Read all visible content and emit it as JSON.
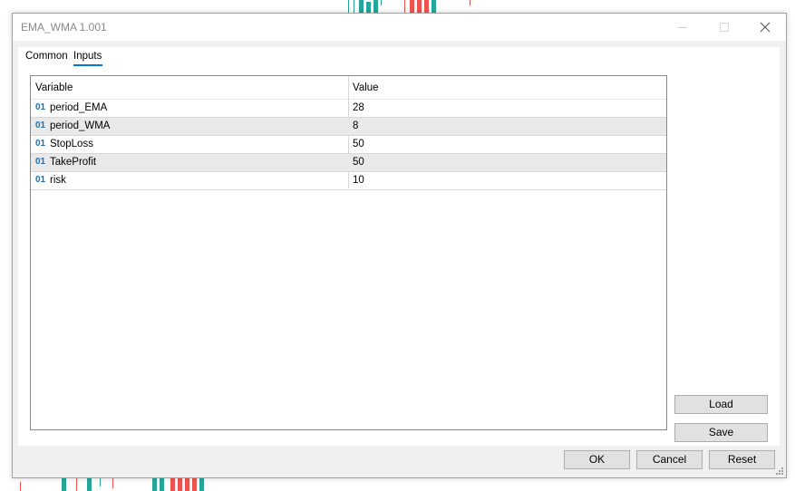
{
  "window": {
    "title": "EMA_WMA 1.001",
    "minimize_glyph": "minimize-icon",
    "maximize_glyph": "maximize-icon",
    "close_glyph": "close-icon"
  },
  "tabs": [
    {
      "label": "Common",
      "active": false
    },
    {
      "label": "Inputs",
      "active": true
    }
  ],
  "grid": {
    "columns": [
      "Variable",
      "Value"
    ],
    "type_icon": "01",
    "rows": [
      {
        "variable": "period_EMA",
        "value": "28"
      },
      {
        "variable": "period_WMA",
        "value": "8"
      },
      {
        "variable": "StopLoss",
        "value": "50"
      },
      {
        "variable": "TakeProfit",
        "value": "50"
      },
      {
        "variable": "risk",
        "value": "10"
      }
    ]
  },
  "side_buttons": {
    "load": "Load",
    "save": "Save"
  },
  "footer_buttons": {
    "ok": "OK",
    "cancel": "Cancel",
    "reset": "Reset"
  },
  "colors": {
    "accent": "#0078d7",
    "bull_candle": "#26a69a",
    "bear_candle": "#ef5350",
    "icon_blue": "#1f6fb0"
  }
}
